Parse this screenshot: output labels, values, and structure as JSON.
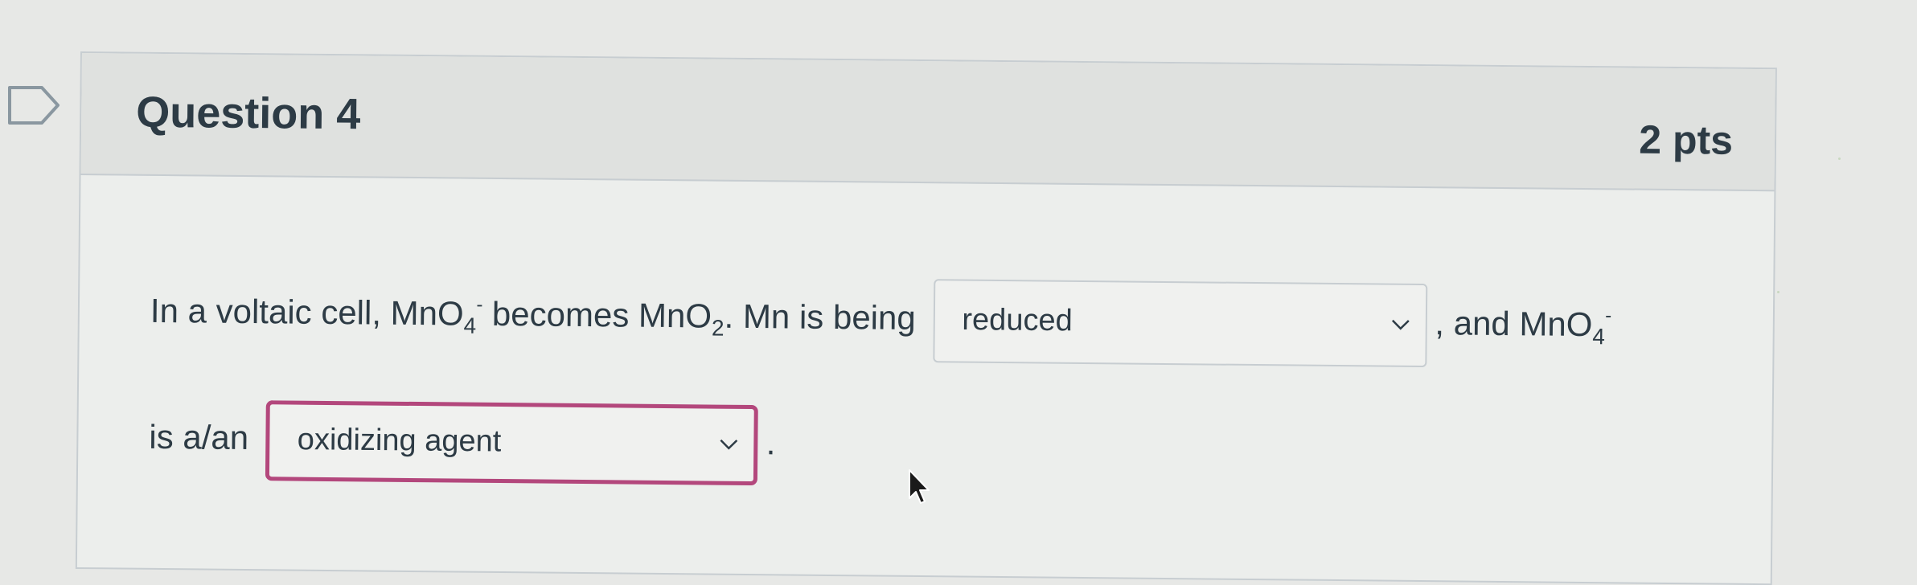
{
  "question": {
    "title": "Question 4",
    "points": "2 pts",
    "text_part1": "In a voltaic cell, MnO",
    "sub_4a": "4",
    "sup_minus_a": "-",
    "text_part2": " becomes MnO",
    "sub_2": "2",
    "text_part3": ". Mn is being",
    "text_part4": ", and MnO",
    "sub_4b": "4",
    "sup_minus_b": "-",
    "text_part5": "is a/an",
    "text_part6": "."
  },
  "dropdowns": {
    "first": {
      "selected": "reduced"
    },
    "second": {
      "selected": "oxidizing agent"
    }
  },
  "colors": {
    "accent_border": "#b3477c",
    "header_bg": "#dfe1df",
    "text": "#2d3b45"
  }
}
